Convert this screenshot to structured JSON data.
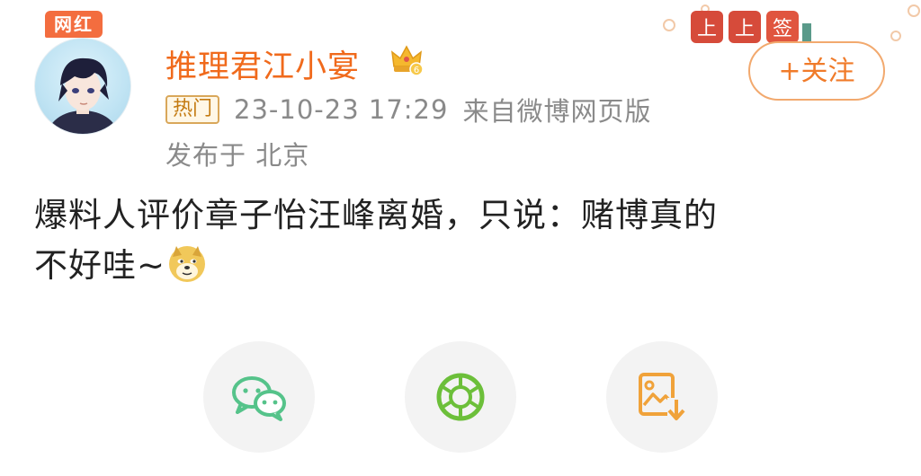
{
  "header": {
    "avatar_badge": "网红",
    "username": "推理君江小宴",
    "level_icon": "crown-icon",
    "hot_badge": "热门",
    "timestamp": "23-10-23 17:29",
    "source": "来自微博网页版",
    "location": "发布于 北京",
    "follow_label": "+关注",
    "deco_labels": [
      "上",
      "上",
      "签"
    ]
  },
  "post": {
    "line1": "爆料人评价章子怡汪峰离婚，只说：赌博真的",
    "line2": "不好哇~",
    "emoji": "doge-emoji-icon"
  },
  "share": {
    "items": [
      "wechat-icon",
      "moments-icon",
      "save-image-icon"
    ]
  },
  "colors": {
    "username": "#f06a1c",
    "follow": "#f07b2a",
    "wechat": "#55c38a",
    "moments": "#6cbf3a",
    "save": "#f0a23a"
  }
}
